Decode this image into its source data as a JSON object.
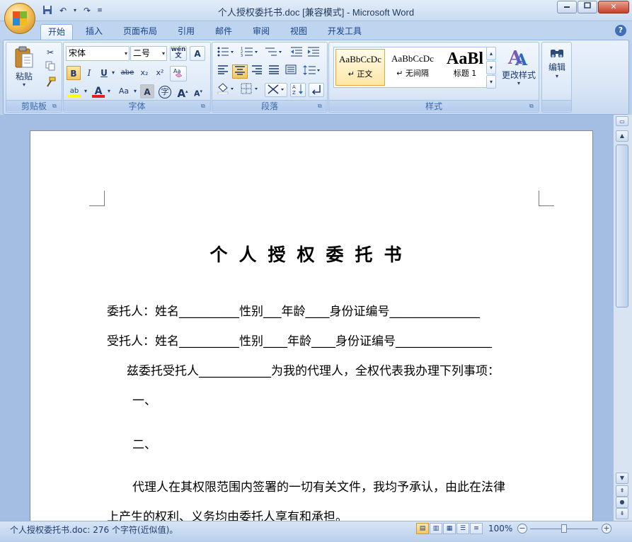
{
  "window": {
    "title": "个人授权委托书.doc [兼容模式] - Microsoft Word",
    "minimize": "▭",
    "maximize": "▢",
    "close": "✕"
  },
  "qat": {
    "save_icon": "save-icon",
    "undo_icon": "undo-icon",
    "redo_icon": "redo-icon",
    "customize_icon": "customize-icon"
  },
  "tabs": [
    {
      "label": "开始",
      "active": true
    },
    {
      "label": "插入"
    },
    {
      "label": "页面布局"
    },
    {
      "label": "引用"
    },
    {
      "label": "邮件"
    },
    {
      "label": "审阅"
    },
    {
      "label": "视图"
    },
    {
      "label": "开发工具"
    }
  ],
  "ribbon": {
    "clipboard": {
      "label": "剪贴板",
      "paste": "粘贴"
    },
    "font": {
      "label": "字体",
      "font_name": "宋体",
      "font_size": "二号",
      "wen": "wén\n文",
      "A_box": "A",
      "bold": "B",
      "italic": "I",
      "underline": "U",
      "strike": "abe",
      "subscript": "x₂",
      "superscript": "x²",
      "highlight": "ab",
      "font_color": "A",
      "change_case": "Aa",
      "shade": "A",
      "enclose": "字",
      "grow": "A",
      "shrink": "A"
    },
    "paragraph": {
      "label": "段落"
    },
    "styles": {
      "label": "样式",
      "items": [
        {
          "sample": "AaBbCcDc",
          "name": "↵ 正文",
          "selected": true
        },
        {
          "sample": "AaBbCcDc",
          "name": "↵ 无间隔"
        },
        {
          "sample": "AaBl",
          "name": "标题 1"
        }
      ],
      "change_styles": "更改样式"
    },
    "editing": {
      "label": "编辑"
    }
  },
  "document": {
    "title": "个人授权委托书",
    "lines": [
      "委托人：姓名__________性别___年龄____身份证编号_______________",
      "受托人：姓名__________性别____年龄____身份证编号________________",
      "兹委托受托人____________为我的代理人，全权代表我办理下列事项：",
      "一、",
      "二、",
      "代理人在其权限范围内签署的一切有关文件，我均予承认，由此在法律",
      "上产生的权利、义务均由委托人享有和承担。"
    ]
  },
  "status": {
    "text": "个人授权委托书.doc: 276 个字符(近似值)。",
    "zoom": "100%",
    "zoom_minus": "−",
    "zoom_plus": "+"
  },
  "colors": {
    "ribbon_text": "#15428b",
    "active_button": "#f8c45f",
    "font_color_bar": "#e02020",
    "highlight_bar": "#ffff00"
  }
}
